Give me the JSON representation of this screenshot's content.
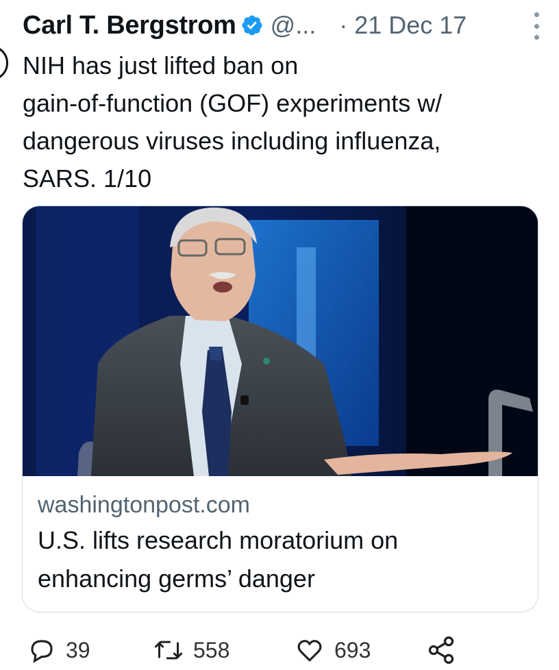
{
  "tweet": {
    "author_name": "Carl T. Bergstrom",
    "handle": "@...",
    "separator": "·",
    "date": "21 Dec 17",
    "text_lines": [
      "NIH has just lifted ban on",
      "gain-of-function (GOF) experiments w/",
      "dangerous viruses including influenza,",
      "SARS. 1/10"
    ]
  },
  "card": {
    "domain": "washingtonpost.com",
    "title_lines": [
      "U.S. lifts research moratorium on",
      "enhancing germs’ danger"
    ]
  },
  "actions": {
    "replies": "39",
    "retweets": "558",
    "likes": "693"
  },
  "colors": {
    "verified_badge": "#1d9bf0",
    "secondary_text": "#536471",
    "card_border": "#cfd9de"
  },
  "icons": [
    "verified-badge-icon",
    "more-options-icon",
    "reply-icon",
    "retweet-icon",
    "like-icon",
    "share-icon"
  ]
}
